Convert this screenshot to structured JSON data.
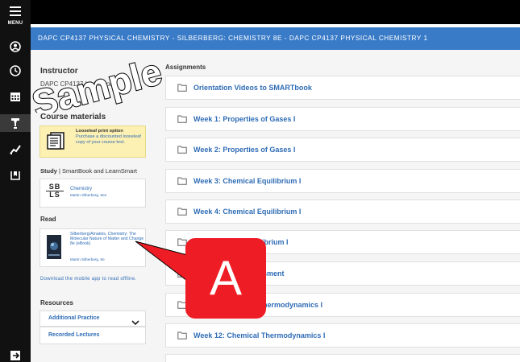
{
  "rail": {
    "menu_label": "MENU",
    "icons": [
      "hamburger-icon",
      "user-circle-icon",
      "clock-icon",
      "calendar-icon",
      "lightbulb-icon",
      "chart-icon",
      "bookmark-icon",
      "exit-icon"
    ]
  },
  "banner": {
    "title": "DAPC CP4137 PHYSICAL CHEMISTRY - SILBERBERG: CHEMISTRY 8E - DAPC CP4137 PHYSICAL CHEMISTRY 1"
  },
  "instructor": {
    "heading": "Instructor",
    "name": "DAPC CP4137 Instructor"
  },
  "course_materials": {
    "heading": "Course materials",
    "looseleaf": {
      "title": "Looseleaf print option",
      "description": "Purchase a discounted looseleaf copy of your course text."
    },
    "study_label": "Study",
    "study_suffix": "| SmartBook and LearnSmart",
    "smartbook": {
      "logo_top": "SB",
      "logo_bottom": "LS",
      "title": "Chemistry",
      "author": "Martin Silberberg, 8ee"
    },
    "read_label": "Read",
    "ebook": {
      "title": "Silberberg/Amateis, Chemistry: The Molecular Nature of Matter and Change 8e (eBook)",
      "author": "Martin Silberberg, 8e"
    },
    "mobile_link": "Download the mobile app to read offline."
  },
  "resources": {
    "heading": "Resources",
    "items": [
      "Additional Practice",
      "Recorded Lectures"
    ]
  },
  "assignments": {
    "heading": "Assignments",
    "items": [
      "Orientation Videos to SMARTbook",
      "Week 1: Properties of Gases I",
      "Week 2: Properties of Gases I",
      "Week 3: Chemical Equilibrium I",
      "Week 4: Chemical Equilibrium I",
      "Week 5: Chemical Equilibrium I",
      "Week 6: Assessment",
      "Week 11: Chemical Thermodynamics I",
      "Week 12: Chemical Thermodynamics I"
    ],
    "visible_text": [
      "Orientation Videos to SMARTbook",
      "Week 1: Properties of Gases I",
      "Week 2: Properties of Gases I",
      "Week 3: Chemical Equilibrium I",
      "Week 4: Chemical Equilibrium I",
      "ilibrium I",
      "sment",
      "hermodynamics I",
      "Week 12: Chemical Thermodynamics I"
    ]
  },
  "overlays": {
    "watermark": "Sample",
    "badge": "A"
  },
  "colors": {
    "banner": "#3a7bc8",
    "link": "#2f6cb5",
    "badge": "#ee1c24",
    "looseleaf_bg": "#fdf0b3"
  }
}
